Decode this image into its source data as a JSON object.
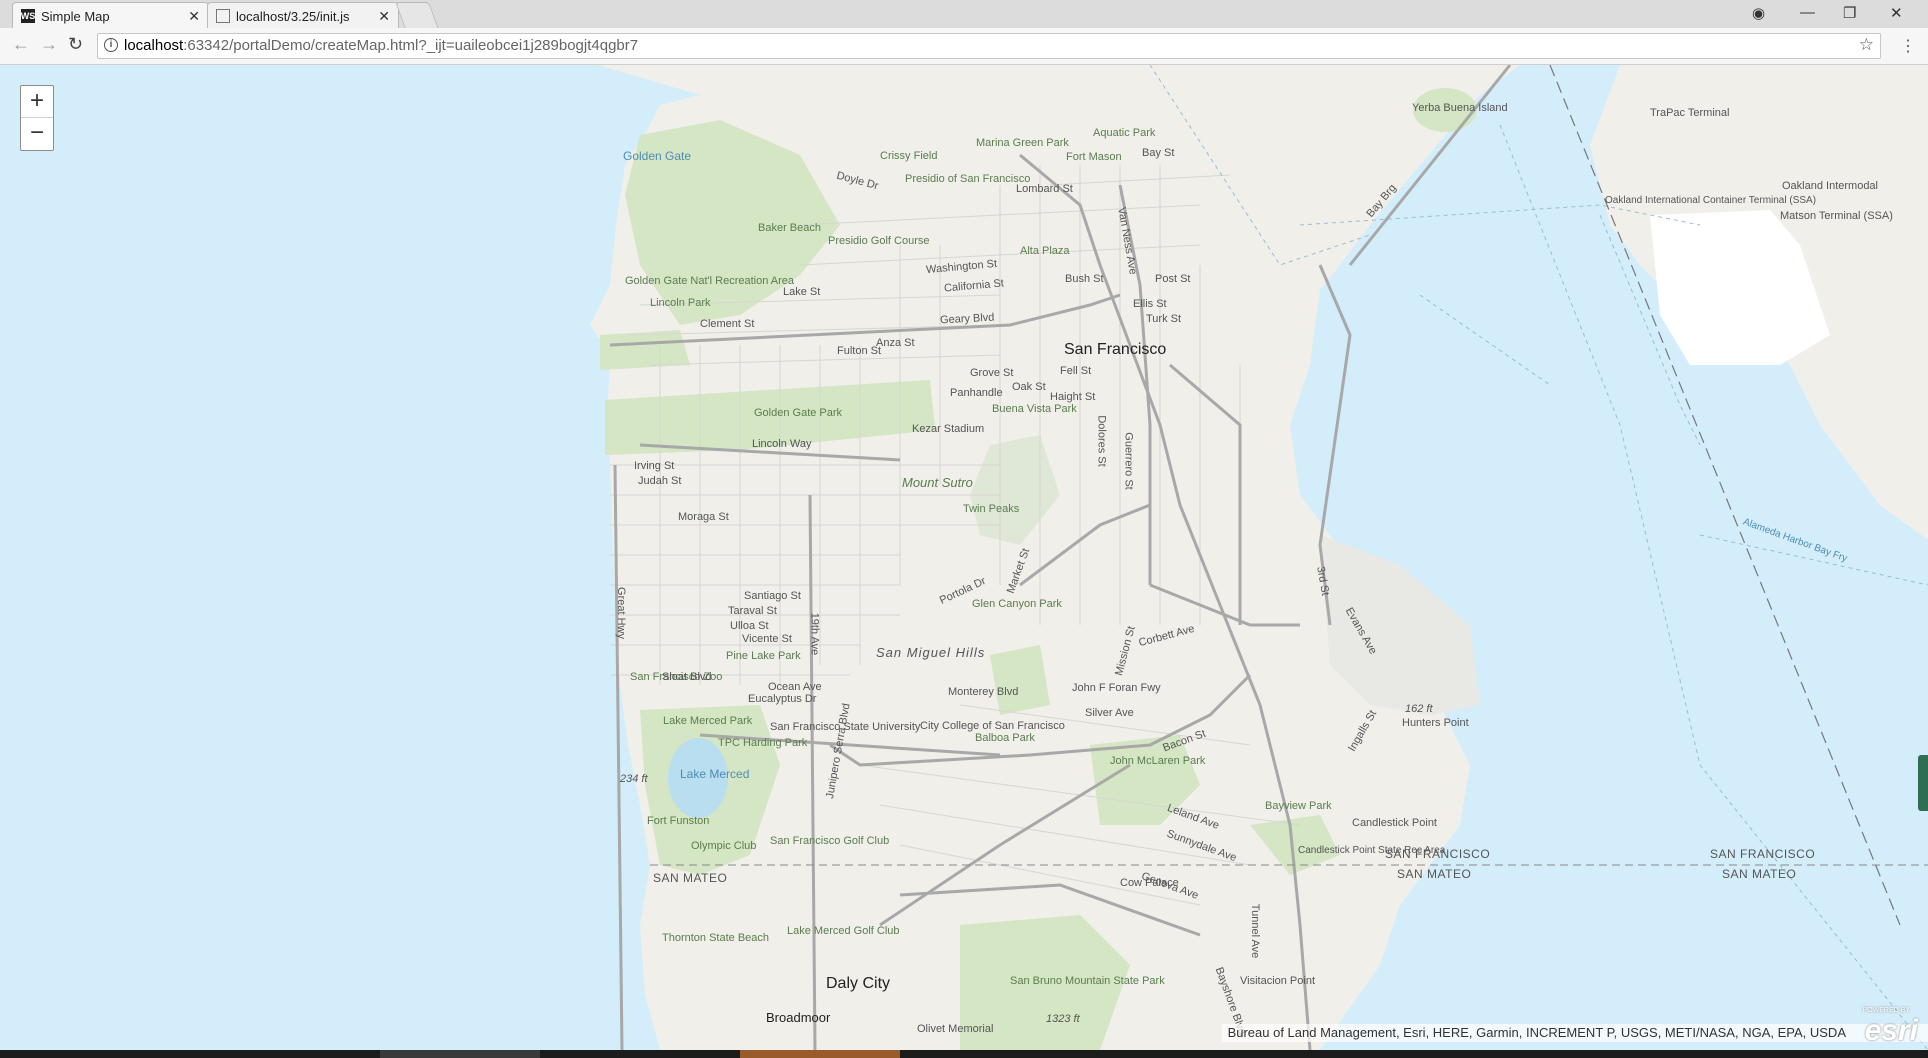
{
  "tabs": [
    {
      "icon": "WS",
      "label": "Simple Map",
      "active": true
    },
    {
      "icon": "doc-icon",
      "label": "localhost/3.25/init.js",
      "active": false
    }
  ],
  "address": {
    "host": "localhost",
    "rest": ":63342/portalDemo/createMap.html?_ijt=uaileobcei1j289bogjt4qgbr7"
  },
  "zoom": {
    "in": "+",
    "out": "−"
  },
  "map": {
    "city_labels": [
      "San Francisco",
      "Daly City",
      "Broadmoor"
    ],
    "county_labels": [
      "SAN FRANCISCO",
      "SAN MATEO",
      "SAN FRANCISCO",
      "SAN MATEO",
      "SAN MATEO",
      "SAN FRANCISCO"
    ],
    "park_labels": [
      "Golden Gate Park",
      "Presidio of San Francisco",
      "Lincoln Park",
      "Golden Gate Nat'l Recreation Area",
      "Marina Green Park",
      "Crissy Field",
      "Baker Beach",
      "Presidio Golf Course",
      "Alta Plaza",
      "Buena Vista Park",
      "Kezar Stadium",
      "Mount Sutro",
      "Twin Peaks",
      "Glen Canyon Park",
      "San Miguel Hills",
      "Pine Lake Park",
      "San Francisco Zoo",
      "Lake Merced Park",
      "TPC Harding Park",
      "San Francisco State University",
      "City College of San Francisco",
      "Balboa Park",
      "John McLaren Park",
      "Bayview Park",
      "Candlestick Point",
      "Candlestick Point State Rec Area",
      "Fort Funston",
      "Olympic Club",
      "San Francisco Golf Club",
      "Lake Merced Golf Club",
      "Thornton State Beach",
      "San Bruno Mountain State Park",
      "Cow Palace",
      "Olivet Memorial",
      "Visitacion Point",
      "Fort Mason",
      "Aquatic Park"
    ],
    "water_labels": [
      "Golden Gate",
      "Lake Merced",
      "Alameda Harbor Bay Fry"
    ],
    "street_labels": [
      "Lombard St",
      "Bay St",
      "Geary Blvd",
      "Fulton St",
      "Lincoln Way",
      "Irving St",
      "Judah St",
      "Moraga St",
      "Santiago St",
      "Taraval St",
      "Ulloa St",
      "Vicente St",
      "Sloat Blvd",
      "Ocean Ave",
      "Eucalyptus Dr",
      "Monterey Blvd",
      "John F Foran Fwy",
      "Silver Ave",
      "Portola Dr",
      "19th Ave",
      "Great Hwy",
      "Van Ness Ave",
      "Fell St",
      "Oak St",
      "Haight St",
      "Market St",
      "Mission St",
      "3rd St",
      "Geneva Ave",
      "Sunnydale Ave",
      "Bayshore Blvd",
      "Junipero Serra Blvd",
      "Bay Brg",
      "Clement St",
      "Anza St",
      "Lake St",
      "California St",
      "Washington St",
      "Post St",
      "Bush St",
      "Ellis St",
      "Turk St",
      "Grove St",
      "Panhandle",
      "Doyle Dr",
      "Dolores St",
      "Guerrero St",
      "Evans Ave",
      "Ingalls St",
      "Bacon St",
      "Leland Ave",
      "Corbett Ave",
      "Yerba Buena Island",
      "TraPac Terminal",
      "Oakland International Container Terminal (SSA)",
      "Oakland Intermodal",
      "Matson Terminal (SSA)",
      "162 ft",
      "234 ft",
      "1323 ft",
      "Hunters Point",
      "Tunnel Ave"
    ],
    "attribution": "Bureau of Land Management, Esri, HERE, Garmin, INCREMENT P, USGS, METI/NASA, NGA, EPA, USDA",
    "logo_text": "esri",
    "logo_caption": "POWERED BY",
    "colors": {
      "water": "#d3eefa",
      "land": "#f0efea",
      "park": "#d4e6c3",
      "road": "#bdbdbd",
      "highway": "#a8a8a8"
    }
  }
}
